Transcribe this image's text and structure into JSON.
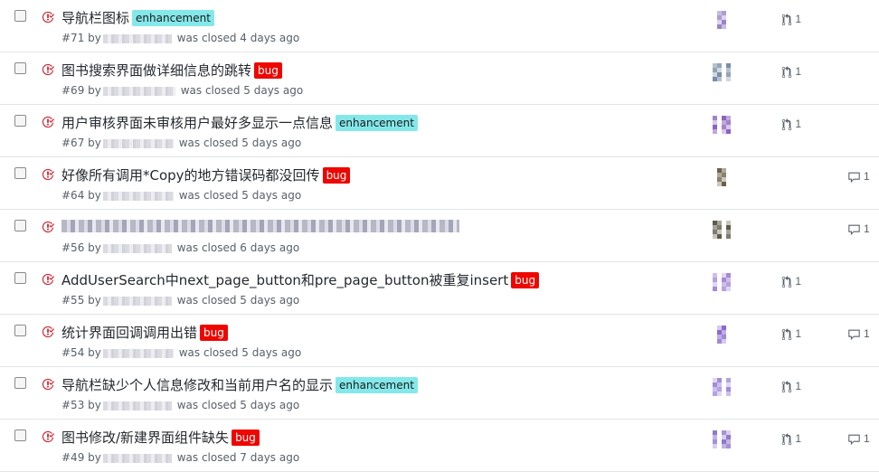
{
  "issues": [
    {
      "title": "导航栏图标",
      "label": "enhancement",
      "label_type": "enhancement",
      "number": "#71",
      "status": "was closed 4 days ago",
      "name_w": 76,
      "pr": "1",
      "comments": "",
      "avatar_color": "#9a84c7"
    },
    {
      "title": "图书搜索界面做详细信息的跳转",
      "label": "bug",
      "label_type": "bug",
      "number": "#69",
      "status": "was closed 5 days ago",
      "name_w": 80,
      "pr": "1",
      "comments": "",
      "avatar_color": "#7a8ea8"
    },
    {
      "title": "用户审核界面未审核用户最好多显示一点信息",
      "label": "enhancement",
      "label_type": "enhancement",
      "number": "#67",
      "status": "was closed 5 days ago",
      "name_w": 78,
      "pr": "1",
      "comments": "",
      "avatar_color": "#8d63c0"
    },
    {
      "title": "好像所有调用*Copy的地方错误码都没回传",
      "label": "bug",
      "label_type": "bug",
      "number": "#64",
      "status": "was closed 5 days ago",
      "name_w": 78,
      "pr": "",
      "comments": "1",
      "avatar_color": "#6b6248"
    },
    {
      "title": "",
      "label": "",
      "label_type": "",
      "number": "#56",
      "status": "was closed 6 days ago",
      "name_w": 76,
      "pr": "",
      "comments": "1",
      "avatar_color": "#5f5a4a",
      "blurred": true
    },
    {
      "title": "AddUserSearch中next_page_button和pre_page_button被重复insert",
      "label": "bug",
      "label_type": "bug",
      "number": "#55",
      "status": "was closed 5 days ago",
      "name_w": 76,
      "pr": "1",
      "comments": "",
      "avatar_color": "#a58ad6"
    },
    {
      "title": "统计界面回调调用出错",
      "label": "bug",
      "label_type": "bug",
      "number": "#54",
      "status": "was closed 5 days ago",
      "name_w": 78,
      "pr": "1",
      "comments": "1",
      "avatar_color": "#8a6ad0"
    },
    {
      "title": "导航栏缺少个人信息修改和当前用户名的显示",
      "label": "enhancement",
      "label_type": "enhancement",
      "number": "#53",
      "status": "was closed 5 days ago",
      "name_w": 76,
      "pr": "1",
      "comments": "",
      "avatar_color": "#a38bd8"
    },
    {
      "title": "图书修改/新建界面组件缺失",
      "label": "bug",
      "label_type": "bug",
      "number": "#49",
      "status": "was closed 7 days ago",
      "name_w": 76,
      "pr": "1",
      "comments": "1",
      "avatar_color": "#9078cc"
    }
  ],
  "meta": {
    "by": "by"
  },
  "colors": {
    "closed_icon": "#cb2431",
    "enhancement": "#84e8ea",
    "bug": "#ee0701",
    "muted": "#586069"
  },
  "icons": {
    "closed": "issue-closed-icon",
    "pr": "git-pull-request-icon",
    "comment": "comment-icon"
  }
}
